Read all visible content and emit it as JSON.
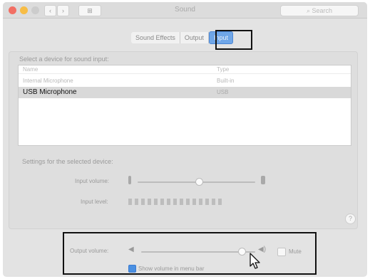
{
  "window": {
    "title": "Sound"
  },
  "toolbar": {
    "search_placeholder": "Search",
    "show_all": ""
  },
  "tabs": [
    {
      "label": "Sound Effects",
      "active": false
    },
    {
      "label": "Output",
      "active": false
    },
    {
      "label": "Input",
      "active": true
    }
  ],
  "input": {
    "select_heading": "Select a device for sound input:",
    "columns": {
      "name": "Name",
      "type": "Type"
    },
    "devices": [
      {
        "name": "Internal Microphone",
        "type": "Built-in",
        "selected": false
      },
      {
        "name": "USB Microphone",
        "type": "USB",
        "selected": true
      }
    ],
    "settings_heading": "Settings for the selected device:",
    "input_volume_label": "Input volume:",
    "input_volume_level": 0.52,
    "input_level_label": "Input level:",
    "input_level_segments": 15
  },
  "output": {
    "volume_label": "Output volume:",
    "volume_level": 0.88,
    "mute_label": "Mute",
    "mute_checked": false,
    "show_in_menubar_label": "Show volume in menu bar",
    "show_in_menubar_checked": true
  },
  "colors": {
    "accent": "#4a90e2",
    "highlight_border": "#111111"
  },
  "icons": [
    "back-icon",
    "forward-icon",
    "grid-icon",
    "search-icon",
    "microphone-icon",
    "speaker-icon",
    "help-icon",
    "mouse-cursor-icon"
  ]
}
